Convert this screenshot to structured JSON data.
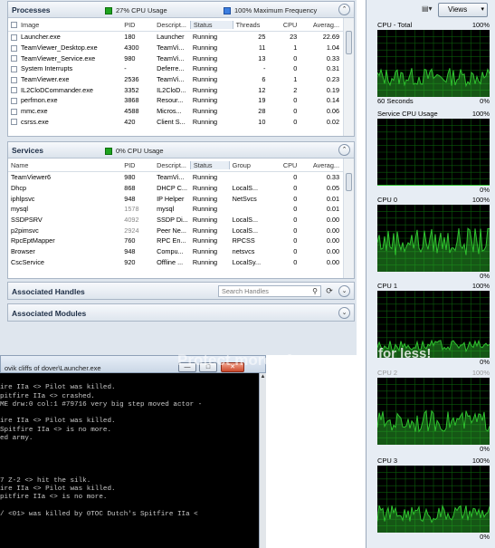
{
  "processes": {
    "title": "Processes",
    "cpu_usage": "27% CPU Usage",
    "max_freq": "100% Maximum Frequency",
    "columns": [
      "Image",
      "PID",
      "Descript...",
      "Status",
      "Threads",
      "CPU",
      "Averag..."
    ],
    "rows": [
      [
        "Launcher.exe",
        "180",
        "Launcher",
        "Running",
        "25",
        "23",
        "22.69"
      ],
      [
        "TeamViewer_Desktop.exe",
        "4300",
        "TeamVi...",
        "Running",
        "11",
        "1",
        "1.04"
      ],
      [
        "TeamViewer_Service.exe",
        "980",
        "TeamVi...",
        "Running",
        "13",
        "0",
        "0.33"
      ],
      [
        "System Interrupts",
        "-",
        "Deferre...",
        "Running",
        "-",
        "0",
        "0.31"
      ],
      [
        "TeamViewer.exe",
        "2536",
        "TeamVi...",
        "Running",
        "6",
        "1",
        "0.23"
      ],
      [
        "IL2CloDCommander.exe",
        "3352",
        "IL2CloD...",
        "Running",
        "12",
        "2",
        "0.19"
      ],
      [
        "perfmon.exe",
        "3868",
        "Resour...",
        "Running",
        "19",
        "0",
        "0.14"
      ],
      [
        "mmc.exe",
        "4588",
        "Micros...",
        "Running",
        "28",
        "0",
        "0.06"
      ],
      [
        "csrss.exe",
        "420",
        "Client S...",
        "Running",
        "10",
        "0",
        "0.02"
      ]
    ]
  },
  "services": {
    "title": "Services",
    "cpu_usage": "0% CPU Usage",
    "columns": [
      "Name",
      "PID",
      "Descript...",
      "Status",
      "Group",
      "CPU",
      "Averag..."
    ],
    "rows": [
      [
        "TeamViewer6",
        "980",
        "TeamVi...",
        "Running",
        "",
        "0",
        "0.33"
      ],
      [
        "Dhcp",
        "868",
        "DHCP C...",
        "Running",
        "LocalS...",
        "0",
        "0.05"
      ],
      [
        "iphlpsvc",
        "948",
        "IP Helper",
        "Running",
        "NetSvcs",
        "0",
        "0.01"
      ],
      [
        "mysql",
        "1578",
        "mysql",
        "Running",
        "",
        "0",
        "0.01"
      ],
      [
        "SSDPSRV",
        "4092",
        "SSDP Di...",
        "Running",
        "LocalS...",
        "0",
        "0.00"
      ],
      [
        "p2pimsvc",
        "2924",
        "Peer Ne...",
        "Running",
        "LocalS...",
        "0",
        "0.00"
      ],
      [
        "RpcEptMapper",
        "760",
        "RPC En...",
        "Running",
        "RPCSS",
        "0",
        "0.00"
      ],
      [
        "Browser",
        "948",
        "Compu...",
        "Running",
        "netsvcs",
        "0",
        "0.00"
      ],
      [
        "CscService",
        "920",
        "Offline ...",
        "Running",
        "LocalSy...",
        "0",
        "0.00"
      ]
    ]
  },
  "handles": {
    "title": "Associated Handles",
    "search_placeholder": "Search Handles"
  },
  "modules": {
    "title": "Associated Modules"
  },
  "right_panel": {
    "views_label": "Views",
    "graphs": [
      {
        "title": "CPU - Total",
        "max": "100%",
        "foot_left": "60 Seconds",
        "foot_right": "0%",
        "level": 0.3,
        "color": "#2fc22f"
      },
      {
        "title": "Service CPU Usage",
        "max": "100%",
        "foot_left": "",
        "foot_right": "0%",
        "level": 0.0,
        "color": "#2fc22f"
      },
      {
        "title": "CPU 0",
        "max": "100%",
        "foot_left": "",
        "foot_right": "0%",
        "level": 0.45,
        "color": "#2fc22f"
      },
      {
        "title": "CPU 1",
        "max": "100%",
        "foot_left": "",
        "foot_right": "0%",
        "level": 0.18,
        "color": "#2fc22f"
      },
      {
        "title": "CPU 2",
        "max": "100%",
        "foot_left": "",
        "foot_right": "0%",
        "level": 0.35,
        "color": "#2fc22f"
      },
      {
        "title": "CPU 3",
        "max": "100%",
        "foot_left": "",
        "foot_right": "0%",
        "level": 0.28,
        "color": "#2fc22f"
      }
    ]
  },
  "console": {
    "title": "ovik cliffs of dover\\Launcher.exe",
    "lines": [
      "",
      "ire IIa <> Pilot was killed.",
      "pitfire IIa <> crashed.",
      "ME drw:0 col:1 #79716 very big step moved actor -",
      "",
      "ire IIa <> Pilot was killed.",
      "Spitfire IIa <> is no more.",
      "ed army.",
      "",
      "",
      "",
      "",
      "7 Z-2 <> hit the silk.",
      "ire IIa <> Pilot was killed.",
      "pitfire IIa <> is no more.",
      "",
      "/ <01> was killed by 0TOC Dutch's Spitfire IIa <"
    ]
  },
  "watermark": {
    "line1": "Protect more of your",
    "line2": "for less!"
  }
}
